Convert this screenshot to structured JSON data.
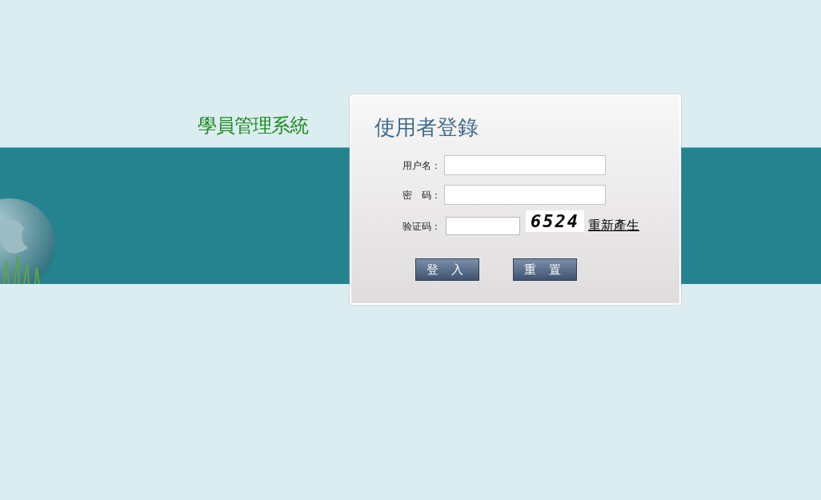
{
  "system_title": "學員管理系統",
  "login": {
    "title": "使用者登錄",
    "fields": [
      {
        "kind": "text",
        "label": "用户名："
      },
      {
        "kind": "password",
        "label": "密　码："
      },
      {
        "kind": "captcha",
        "label": "验证码：",
        "captcha": "6524",
        "refresh_link": "重新產生"
      }
    ],
    "buttons": [
      "登 入",
      "重 置"
    ]
  }
}
